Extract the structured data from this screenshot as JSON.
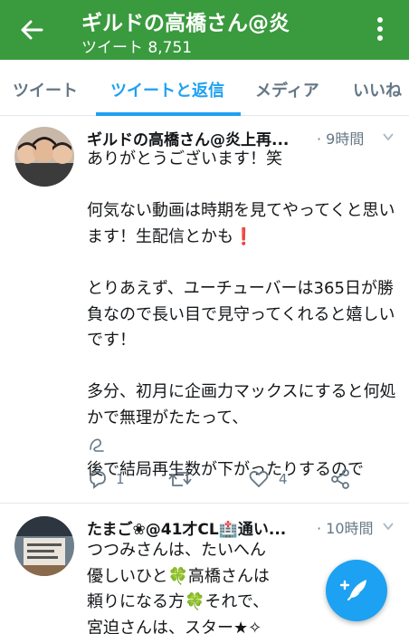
{
  "header": {
    "title": "ギルドの高橋さん@炎",
    "subtitle": "ツイート 8,751",
    "color": "#3a9a3e"
  },
  "tabs": [
    {
      "label": "ツイート",
      "active": false
    },
    {
      "label": "ツイートと返信",
      "active": true
    },
    {
      "label": "メディア",
      "active": false
    },
    {
      "label": "いいね",
      "active": false
    }
  ],
  "tweets": [
    {
      "name": "ギルドの高橋さん@炎上再...",
      "time": "· 9時間",
      "text": "ありがとうございます！笑\n\n何気ない動画は時期を見てやってくと思います！生配信とかも❗\n\nとりあえず、ユーチューバーは365日が勝負なので長い目で見守ってくれると嬉しいです！\n\n多分、初月に企画力マックスにすると何処かで無理がたたって、\n\n後で結局再生数が下がったりするので",
      "reply_count": "1",
      "retweet_count": "",
      "like_count": "4"
    },
    {
      "name": "たまご❀@41才CL🏥通い...",
      "time": "· 10時間",
      "text": "つつみさんは、たいへん\n優しいひと🍀高橋さんは\n頼りになる方🍀それで、\n宮迫さんは、スター★✧"
    }
  ],
  "accent_color": "#1da1f2"
}
